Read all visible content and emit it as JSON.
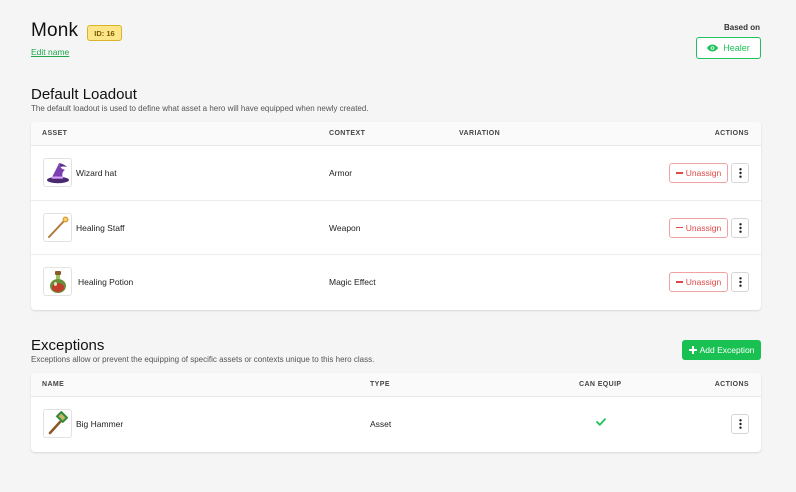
{
  "header": {
    "title": "Monk",
    "id_badge": "ID: 16",
    "edit_link": "Edit name",
    "based_on_label": "Based on",
    "based_on_button": "Healer"
  },
  "loadout": {
    "title": "Default Loadout",
    "description": "The default loadout is used to define what asset a hero will have equipped when newly created.",
    "columns": [
      "ASSET",
      "CONTEXT",
      "VARIATION",
      "ACTIONS"
    ],
    "rows": [
      {
        "asset": "Wizard hat",
        "context": "Armor",
        "variation": "",
        "icon": "wizard-hat-icon",
        "action": "Unassign"
      },
      {
        "asset": "Healing Staff",
        "context": "Weapon",
        "variation": "",
        "icon": "healing-staff-icon",
        "action": "Unassign"
      },
      {
        "asset": "Healing Potion",
        "context": "Magic Effect",
        "variation": "",
        "icon": "healing-potion-icon",
        "action": "Unassign"
      }
    ]
  },
  "exceptions": {
    "title": "Exceptions",
    "description": "Exceptions allow or prevent the equipping of specific assets or contexts unique to this hero class.",
    "add_button": "Add Exception",
    "columns": [
      "NAME",
      "TYPE",
      "CAN EQUIP",
      "ACTIONS"
    ],
    "rows": [
      {
        "name": "Big Hammer",
        "type": "Asset",
        "can_equip": true,
        "icon": "big-hammer-icon"
      }
    ]
  },
  "colors": {
    "accent_green": "#19c153",
    "danger_red": "#e04848",
    "badge_yellow": "#fde58a"
  }
}
